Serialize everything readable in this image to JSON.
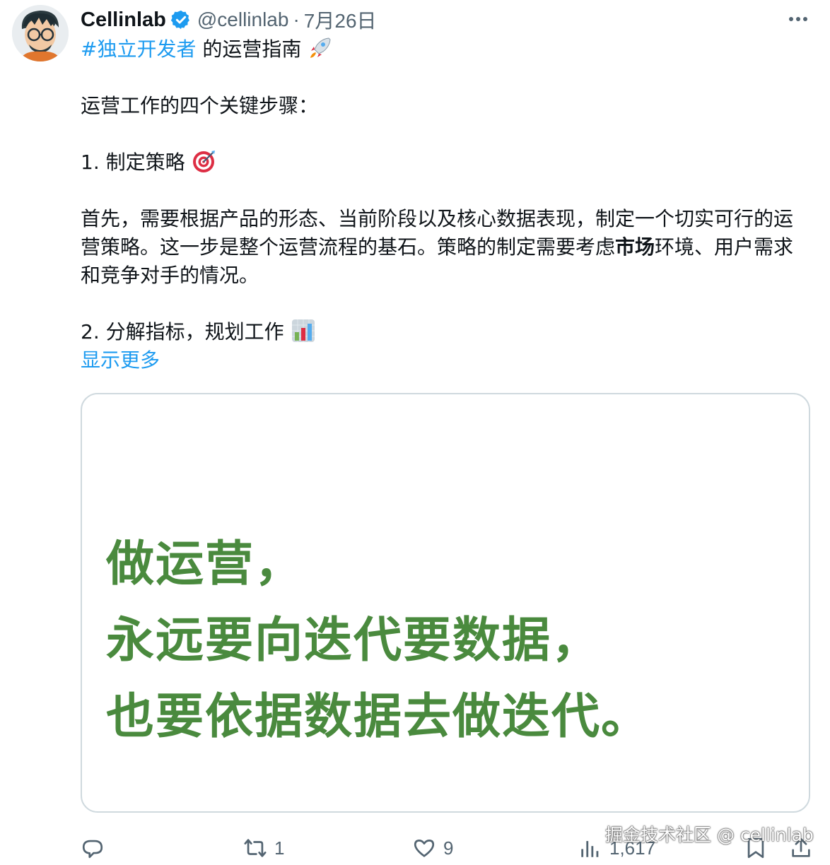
{
  "tweet": {
    "author": {
      "display_name": "Cellinlab",
      "handle": "@cellinlab",
      "verified_icon": "verified-badge-icon",
      "avatar_icon": "avatar-illustration"
    },
    "separator": "·",
    "date": "7月26日",
    "more_icon": "more-dots-icon",
    "line1": {
      "hashtag": "#独立开发者",
      "rest": " 的运营指南 ",
      "emoji": "rocket-icon"
    },
    "line2": "运营工作的四个关键步骤：",
    "step1": {
      "text": "1. 制定策略 ",
      "emoji": "target-icon"
    },
    "para1_part1": "首先，需要根据产品的形态、当前阶段以及核心数据表现，制定一个切实可行的运营策略。这一步是整个运营流程的基石。策略的制定需要考虑",
    "para1_bold": "市场",
    "para1_part2": "环境、用户需求和竞争对手的情况。",
    "step2": {
      "text": "2. 分解指标，规划工作 ",
      "emoji": "bar-chart-icon"
    },
    "show_more": "显示更多"
  },
  "media": {
    "quote_lines": [
      "做运营，",
      "永远要向迭代要数据，",
      "也要依据数据去做迭代。"
    ],
    "text_color": "#4a8a3e"
  },
  "actions": {
    "reply": {
      "icon": "reply-icon",
      "count": ""
    },
    "retweet": {
      "icon": "retweet-icon",
      "count": "1"
    },
    "like": {
      "icon": "heart-icon",
      "count": "9"
    },
    "views": {
      "icon": "views-icon",
      "count": "1,617"
    },
    "bookmark": {
      "icon": "bookmark-icon"
    },
    "share": {
      "icon": "share-icon"
    }
  },
  "watermark": "掘金技术社区 @ cellinlab",
  "colors": {
    "link": "#1d9bf0",
    "secondary_text": "#536471",
    "primary_text": "#0f1419",
    "border": "#cfd9de"
  }
}
